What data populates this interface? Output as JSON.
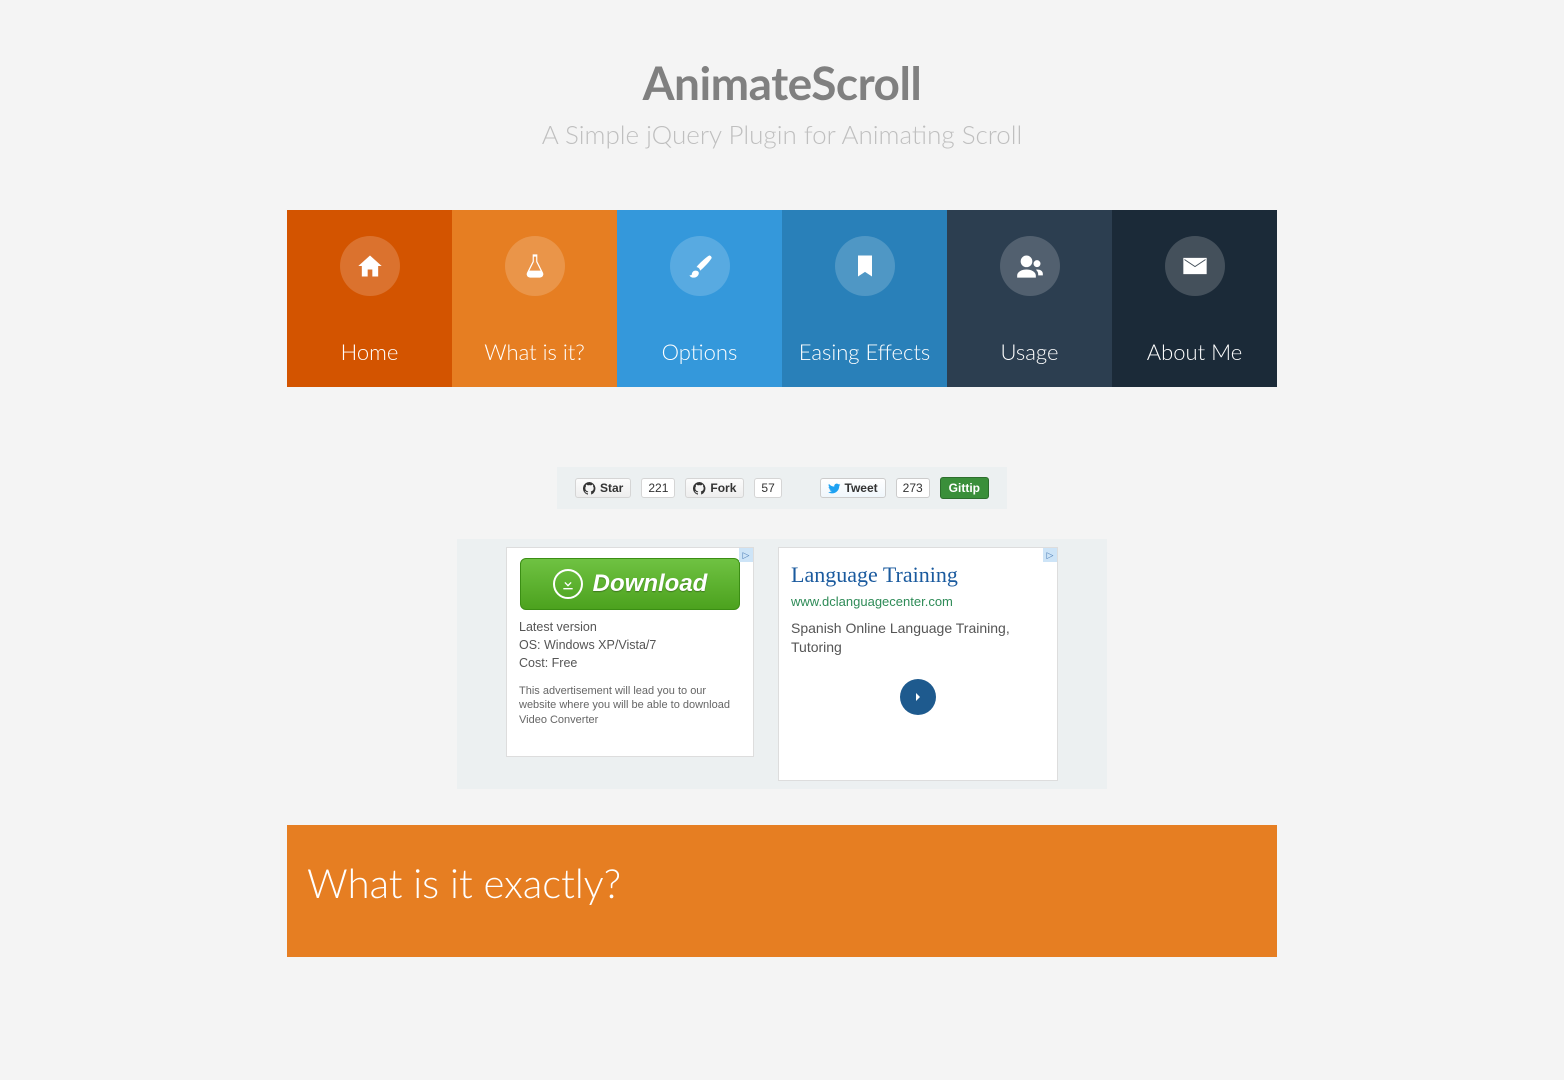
{
  "header": {
    "title": "AnimateScroll",
    "subtitle": "A Simple jQuery Plugin for Animating Scroll"
  },
  "nav": {
    "items": [
      {
        "label": "Home"
      },
      {
        "label": "What is it?"
      },
      {
        "label": "Options"
      },
      {
        "label": "Easing Effects"
      },
      {
        "label": "Usage"
      },
      {
        "label": "About Me"
      }
    ]
  },
  "social": {
    "star_label": "Star",
    "star_count": "221",
    "fork_label": "Fork",
    "fork_count": "57",
    "tweet_label": "Tweet",
    "tweet_count": "273",
    "gittip_label": "Gittip"
  },
  "ads": {
    "ad1": {
      "button": "Download",
      "line1": "Latest version",
      "line2": "OS: Windows XP/Vista/7",
      "line3": "Cost: Free",
      "note": "This advertisement will lead you to our website where you will be able to download Video Converter"
    },
    "ad2": {
      "title": "Language Training",
      "url": "www.dclanguagecenter.com",
      "desc": "Spanish Online Language Training, Tutoring"
    },
    "badge": "▷"
  },
  "section": {
    "heading": "What is it exactly?"
  }
}
